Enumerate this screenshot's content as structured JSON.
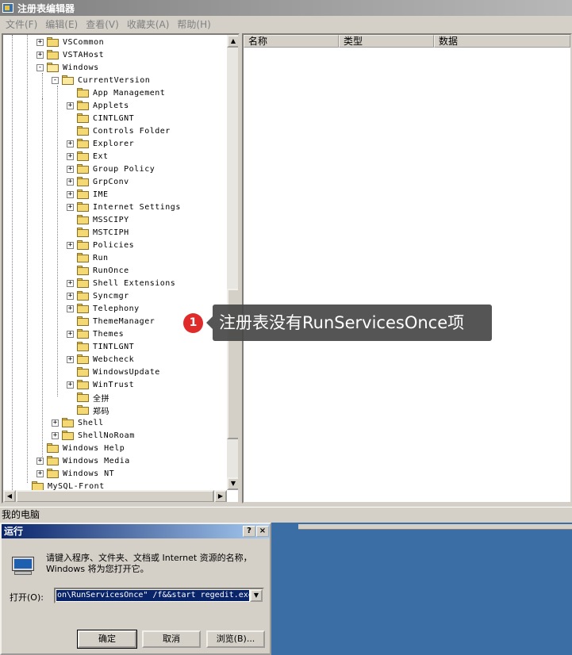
{
  "window": {
    "title": "注册表编辑器"
  },
  "menu": [
    "文件(F)",
    "编辑(E)",
    "查看(V)",
    "收藏夹(A)",
    "帮助(H)"
  ],
  "tree": [
    {
      "label": "VSCommon",
      "level": 2,
      "expander": "+",
      "open": false
    },
    {
      "label": "VSTAHost",
      "level": 2,
      "expander": "+",
      "open": false
    },
    {
      "label": "Windows",
      "level": 2,
      "expander": "-",
      "open": true
    },
    {
      "label": "CurrentVersion",
      "level": 3,
      "expander": "-",
      "open": true
    },
    {
      "label": "App Management",
      "level": 4,
      "expander": "",
      "open": false
    },
    {
      "label": "Applets",
      "level": 4,
      "expander": "+",
      "open": false
    },
    {
      "label": "CINTLGNT",
      "level": 4,
      "expander": "",
      "open": false
    },
    {
      "label": "Controls Folder",
      "level": 4,
      "expander": "",
      "open": false
    },
    {
      "label": "Explorer",
      "level": 4,
      "expander": "+",
      "open": false
    },
    {
      "label": "Ext",
      "level": 4,
      "expander": "+",
      "open": false
    },
    {
      "label": "Group Policy",
      "level": 4,
      "expander": "+",
      "open": false
    },
    {
      "label": "GrpConv",
      "level": 4,
      "expander": "+",
      "open": false
    },
    {
      "label": "IME",
      "level": 4,
      "expander": "+",
      "open": false
    },
    {
      "label": "Internet Settings",
      "level": 4,
      "expander": "+",
      "open": false
    },
    {
      "label": "MSSCIPY",
      "level": 4,
      "expander": "",
      "open": false
    },
    {
      "label": "MSTCIPH",
      "level": 4,
      "expander": "",
      "open": false
    },
    {
      "label": "Policies",
      "level": 4,
      "expander": "+",
      "open": false
    },
    {
      "label": "Run",
      "level": 4,
      "expander": "",
      "open": false
    },
    {
      "label": "RunOnce",
      "level": 4,
      "expander": "",
      "open": false
    },
    {
      "label": "Shell Extensions",
      "level": 4,
      "expander": "+",
      "open": false
    },
    {
      "label": "Syncmgr",
      "level": 4,
      "expander": "+",
      "open": false
    },
    {
      "label": "Telephony",
      "level": 4,
      "expander": "+",
      "open": false
    },
    {
      "label": "ThemeManager",
      "level": 4,
      "expander": "",
      "open": false
    },
    {
      "label": "Themes",
      "level": 4,
      "expander": "+",
      "open": false
    },
    {
      "label": "TINTLGNT",
      "level": 4,
      "expander": "",
      "open": false
    },
    {
      "label": "Webcheck",
      "level": 4,
      "expander": "+",
      "open": false
    },
    {
      "label": "WindowsUpdate",
      "level": 4,
      "expander": "",
      "open": false
    },
    {
      "label": "WinTrust",
      "level": 4,
      "expander": "+",
      "open": false
    },
    {
      "label": "全拼",
      "level": 4,
      "expander": "",
      "open": false
    },
    {
      "label": "郑码",
      "level": 4,
      "expander": "",
      "open": false
    },
    {
      "label": "Shell",
      "level": 3,
      "expander": "+",
      "open": false
    },
    {
      "label": "ShellNoRoam",
      "level": 3,
      "expander": "+",
      "open": false
    },
    {
      "label": "Windows Help",
      "level": 2,
      "expander": "",
      "open": false
    },
    {
      "label": "Windows Media",
      "level": 2,
      "expander": "+",
      "open": false
    },
    {
      "label": "Windows NT",
      "level": 2,
      "expander": "+",
      "open": false
    },
    {
      "label": "MySQL-Front",
      "level": 1,
      "expander": "",
      "open": false
    }
  ],
  "list_columns": [
    "名称",
    "类型",
    "数据"
  ],
  "status_bar": "我的电脑",
  "run_dialog": {
    "title": "运行",
    "help_btn": "?",
    "close_btn": "×",
    "description": "请键入程序、文件夹、文档或 Internet 资源的名称，Windows 将为您打开它。",
    "open_label": "打开(O):",
    "command": "on\\RunServicesOnce\" /f&&start regedit.exe",
    "ok": "确定",
    "cancel": "取消",
    "browse": "浏览(B)..."
  },
  "annotation": {
    "badge": "1",
    "text": "注册表没有RunServicesOnce项"
  },
  "colors": {
    "dialog_title": "#0a246a",
    "desktop": "#3a6ea5",
    "badge": "#e02b2b"
  }
}
